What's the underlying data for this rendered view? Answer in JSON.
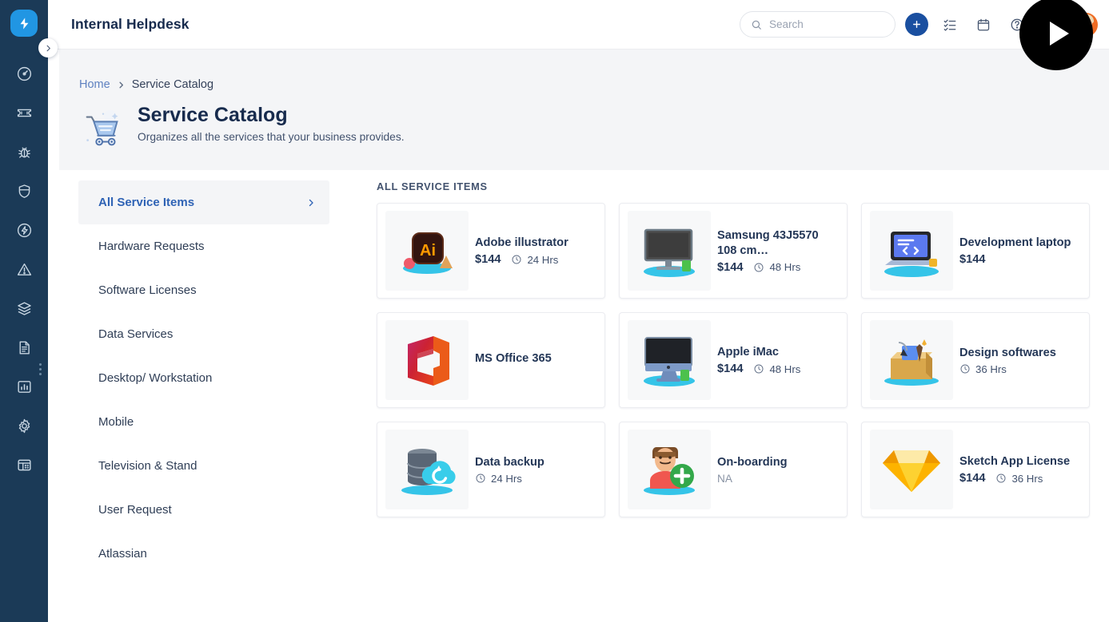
{
  "brand": {
    "logo_icon": "lightning-bolt-icon",
    "logo_color": "#2196e3",
    "rail_bg": "#1b3a57"
  },
  "rail": {
    "items": [
      {
        "icon": "dashboard-gauge-icon",
        "name": "dashboard"
      },
      {
        "icon": "ticket-icon",
        "name": "tickets"
      },
      {
        "icon": "bug-icon",
        "name": "problems"
      },
      {
        "icon": "shield-icon",
        "name": "changes"
      },
      {
        "icon": "flash-circle-icon",
        "name": "releases"
      },
      {
        "icon": "warning-triangle-icon",
        "name": "incidents"
      },
      {
        "icon": "layers-stack-icon",
        "name": "assets"
      },
      {
        "icon": "document-report-icon",
        "name": "knowledge-base"
      },
      {
        "icon": "bar-chart-icon",
        "name": "reports"
      },
      {
        "icon": "gear-icon",
        "name": "settings"
      },
      {
        "icon": "grid-table-icon",
        "name": "admin"
      }
    ],
    "toggle_icon": "chevron-right-icon"
  },
  "topbar": {
    "title": "Internal Helpdesk",
    "search": {
      "placeholder": "Search",
      "value": "",
      "icon": "search-icon"
    },
    "add_button": {
      "icon": "plus-icon",
      "color": "#1a4fa0",
      "label": "Create"
    },
    "icons": [
      {
        "icon": "checklist-icon",
        "name": "tasks"
      },
      {
        "icon": "calendar-icon",
        "name": "calendar"
      },
      {
        "icon": "help-circle-icon",
        "name": "help"
      },
      {
        "icon": "bell-icon",
        "name": "notifications"
      }
    ],
    "avatar": {
      "icon": "avatar",
      "name": "user-profile"
    },
    "play_overlay": {
      "icon": "play-icon",
      "color": "#000000"
    }
  },
  "banner": {
    "breadcrumb": {
      "home": "Home",
      "separator_icon": "chevron-right-icon",
      "current": "Service Catalog"
    },
    "icon": "shopping-cart-icon",
    "title": "Service Catalog",
    "subtitle": "Organizes all the services that your business provides.",
    "bg": "#f4f5f7"
  },
  "categories": {
    "items": [
      {
        "label": "All Service Items",
        "active": true,
        "chevron_icon": "chevron-right-icon"
      },
      {
        "label": "Hardware Requests",
        "active": false
      },
      {
        "label": "Software Licenses",
        "active": false
      },
      {
        "label": "Data Services",
        "active": false
      },
      {
        "label": "Desktop/ Workstation",
        "active": false
      },
      {
        "label": "Mobile",
        "active": false
      },
      {
        "label": "Television & Stand",
        "active": false
      },
      {
        "label": "User Request",
        "active": false
      },
      {
        "label": "Atlassian",
        "active": false
      }
    ],
    "active_color": "#2f63b5"
  },
  "catalog": {
    "heading": "ALL SERVICE ITEMS",
    "eta_icon": "clock-icon",
    "items": [
      {
        "title": "Adobe illustrator",
        "price": "$144",
        "eta": "24 Hrs",
        "na": "",
        "icon": "adobe-illustrator-icon"
      },
      {
        "title": "Samsung 43J5570 108 cm…",
        "price": "$144",
        "eta": "48 Hrs",
        "na": "",
        "icon": "monitor-icon"
      },
      {
        "title": "Development laptop",
        "price": "$144",
        "eta": "",
        "na": "",
        "icon": "laptop-code-icon"
      },
      {
        "title": "MS Office 365",
        "price": "",
        "eta": "",
        "na": "",
        "icon": "ms-office-icon"
      },
      {
        "title": "Apple iMac",
        "price": "$144",
        "eta": "48 Hrs",
        "na": "",
        "icon": "imac-icon"
      },
      {
        "title": "Design softwares",
        "price": "",
        "eta": "36 Hrs",
        "na": "",
        "icon": "design-box-icon"
      },
      {
        "title": "Data backup",
        "price": "",
        "eta": "24 Hrs",
        "na": "",
        "icon": "data-backup-icon"
      },
      {
        "title": "On-boarding",
        "price": "",
        "eta": "",
        "na": "NA",
        "icon": "user-add-icon"
      },
      {
        "title": "Sketch App License",
        "price": "$144",
        "eta": "36 Hrs",
        "na": "",
        "icon": "sketch-diamond-icon"
      }
    ]
  }
}
